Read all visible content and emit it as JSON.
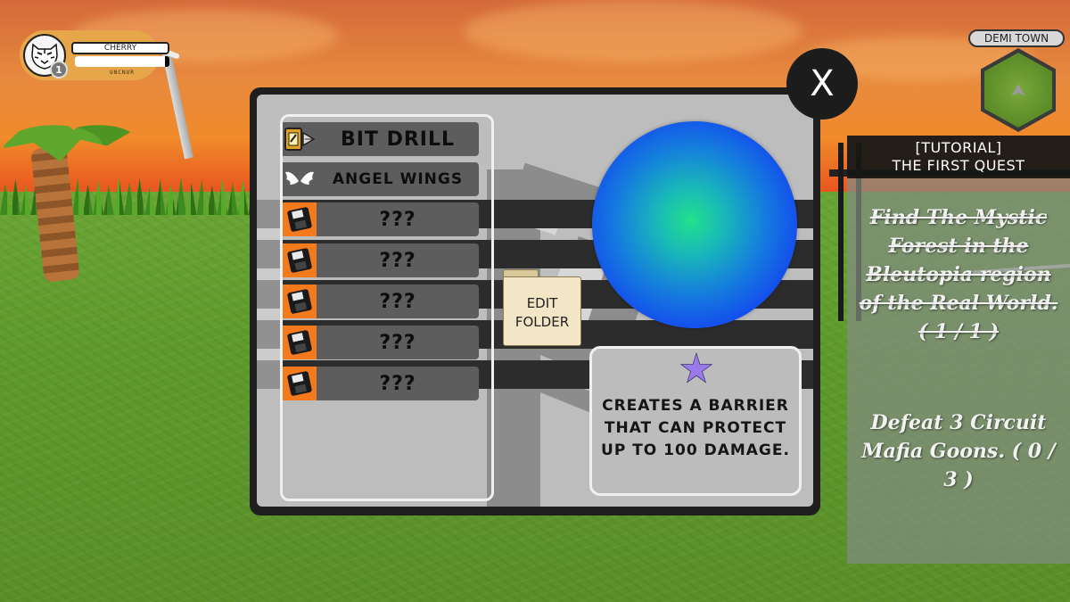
{
  "player": {
    "name": "CHERRY",
    "level": "1",
    "subtitle": "UNCNUR",
    "hp_fraction": 0.95
  },
  "minimap": {
    "location": "DEMI TOWN"
  },
  "quest": {
    "title_line1": "[TUTORIAL]",
    "title_line2": "THE FIRST QUEST",
    "objective1": "Find The Mystic Forest in the Bleutopia region of the Real World. ( 1 / 1 )",
    "objective2": "Defeat 3 Circuit Mafia Goons. ( 0 / 3 )"
  },
  "dialog": {
    "close_label": "X",
    "items": [
      {
        "label": "BIT DRILL",
        "icon": "drill-chip-icon",
        "locked": false
      },
      {
        "label": "ANGEL WINGS",
        "icon": "angel-wings-icon",
        "locked": false
      },
      {
        "label": "???",
        "icon": "floppy-disk-icon",
        "locked": true
      },
      {
        "label": "???",
        "icon": "floppy-disk-icon",
        "locked": true
      },
      {
        "label": "???",
        "icon": "floppy-disk-icon",
        "locked": true
      },
      {
        "label": "???",
        "icon": "floppy-disk-icon",
        "locked": true
      },
      {
        "label": "???",
        "icon": "floppy-disk-icon",
        "locked": true
      }
    ],
    "edit_folder_line1": "EDIT",
    "edit_folder_line2": "FOLDER",
    "description": "CREATES A BARRIER THAT CAN PROTECT UP TO 100 DAMAGE.",
    "star_icon": "star-icon"
  },
  "colors": {
    "accent_orange": "#f47a1c",
    "orb_blue": "#1447f0",
    "orb_green": "#22e08a",
    "star_purple": "#9a7ae8"
  }
}
